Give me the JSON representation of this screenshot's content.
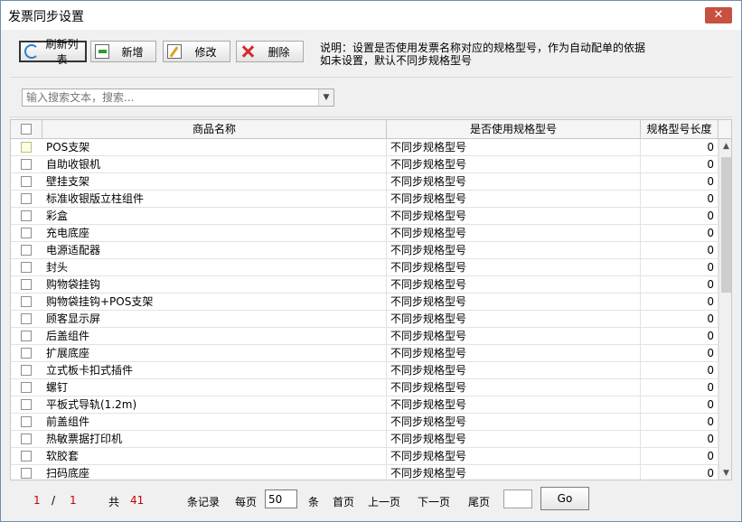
{
  "window": {
    "title": "发票同步设置"
  },
  "toolbar": {
    "refresh_label": "刷新列表",
    "add_label": "新增",
    "edit_label": "修改",
    "delete_label": "删除"
  },
  "note": {
    "line1": "说明：设置是否使用发票名称对应的规格型号，作为自动配单的依据",
    "line2": "如未设置，默认不同步规格型号"
  },
  "search": {
    "placeholder": "输入搜索文本，搜索..."
  },
  "grid": {
    "columns": [
      "商品名称",
      "是否使用规格型号",
      "规格型号长度"
    ],
    "rows": [
      {
        "name": "POS支架",
        "use": "不同步规格型号",
        "len": "0"
      },
      {
        "name": "自助收银机",
        "use": "不同步规格型号",
        "len": "0"
      },
      {
        "name": "壁挂支架",
        "use": "不同步规格型号",
        "len": "0"
      },
      {
        "name": "标准收银版立柱组件",
        "use": "不同步规格型号",
        "len": "0"
      },
      {
        "name": "彩盒",
        "use": "不同步规格型号",
        "len": "0"
      },
      {
        "name": "充电底座",
        "use": "不同步规格型号",
        "len": "0"
      },
      {
        "name": "电源适配器",
        "use": "不同步规格型号",
        "len": "0"
      },
      {
        "name": "封头",
        "use": "不同步规格型号",
        "len": "0"
      },
      {
        "name": "购物袋挂钩",
        "use": "不同步规格型号",
        "len": "0"
      },
      {
        "name": "购物袋挂钩+POS支架",
        "use": "不同步规格型号",
        "len": "0"
      },
      {
        "name": "顾客显示屏",
        "use": "不同步规格型号",
        "len": "0"
      },
      {
        "name": "后盖组件",
        "use": "不同步规格型号",
        "len": "0"
      },
      {
        "name": "扩展底座",
        "use": "不同步规格型号",
        "len": "0"
      },
      {
        "name": "立式板卡扣式插件",
        "use": "不同步规格型号",
        "len": "0"
      },
      {
        "name": "螺钉",
        "use": "不同步规格型号",
        "len": "0"
      },
      {
        "name": "平板式导轨(1.2m)",
        "use": "不同步规格型号",
        "len": "0"
      },
      {
        "name": "前盖组件",
        "use": "不同步规格型号",
        "len": "0"
      },
      {
        "name": "热敏票据打印机",
        "use": "不同步规格型号",
        "len": "0"
      },
      {
        "name": "软胶套",
        "use": "不同步规格型号",
        "len": "0"
      },
      {
        "name": "扫码底座",
        "use": "不同步规格型号",
        "len": "0"
      }
    ]
  },
  "pager": {
    "current": "1",
    "slash": "/",
    "total_pages": "1",
    "total_prefix": "共",
    "total_records": "41",
    "records_suffix": "条记录",
    "per_page_label": "每页",
    "per_page_value": "50",
    "per_page_suffix": "条",
    "first": "首页",
    "prev": "上一页",
    "next": "下一页",
    "last": "尾页",
    "go": "Go"
  },
  "icons": {
    "refresh": "refresh-icon",
    "add": "add-icon",
    "edit": "edit-icon",
    "delete": "delete-icon",
    "close": "close-icon"
  }
}
